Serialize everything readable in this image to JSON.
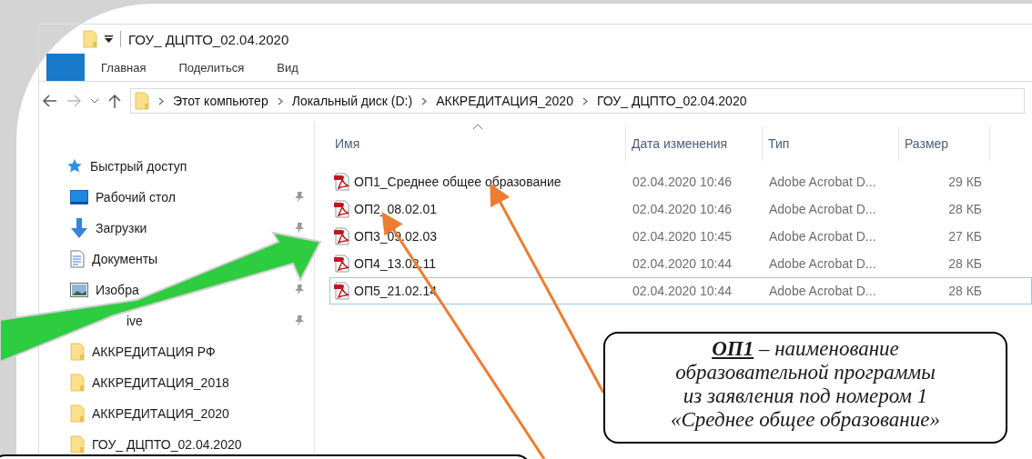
{
  "window": {
    "title": "ГОУ_ ДЦПТО_02.04.2020"
  },
  "ribbon": {
    "tabs": [
      {
        "label": "Главная"
      },
      {
        "label": "Поделиться"
      },
      {
        "label": "Вид"
      }
    ]
  },
  "address_bar": {
    "path": [
      "Этот компьютер",
      "Локальный диск (D:)",
      "АККРЕДИТАЦИЯ_2020",
      "ГОУ_ ДЦПТО_02.04.2020"
    ]
  },
  "sidebar": {
    "items": [
      {
        "kind": "quick-access",
        "label": "Быстрый доступ",
        "pinned": false
      },
      {
        "kind": "desktop",
        "label": "Рабочий стол",
        "pinned": true
      },
      {
        "kind": "downloads",
        "label": "Загрузки",
        "pinned": true
      },
      {
        "kind": "documents",
        "label": "Документы",
        "pinned": false
      },
      {
        "kind": "pictures",
        "label": "Изобра",
        "pinned": true
      },
      {
        "kind": "cloud",
        "label": "ive",
        "pinned": true
      },
      {
        "kind": "folder",
        "label": "АККРЕДИТАЦИЯ РФ",
        "pinned": false
      },
      {
        "kind": "folder",
        "label": "АККРЕДИТАЦИЯ_2018",
        "pinned": false
      },
      {
        "kind": "folder",
        "label": "АККРЕДИТАЦИЯ_2020",
        "pinned": false
      },
      {
        "kind": "folder",
        "label": "ГОУ_ ДЦПТО_02.04.2020",
        "pinned": false
      }
    ]
  },
  "file_list": {
    "columns": [
      {
        "label": "Имя",
        "sorted": true
      },
      {
        "label": "Дата изменения",
        "sorted": false
      },
      {
        "label": "Тип",
        "sorted": false
      },
      {
        "label": "Размер",
        "sorted": false
      }
    ],
    "rows": [
      {
        "name": "ОП1_Среднее общее образование",
        "modified": "02.04.2020 10:46",
        "type": "Adobe Acrobat D...",
        "size": "29 КБ",
        "focused": false
      },
      {
        "name": "ОП2_08.02.01",
        "modified": "02.04.2020 10:46",
        "type": "Adobe Acrobat D...",
        "size": "28 КБ",
        "focused": false
      },
      {
        "name": "ОП3_09.02.03",
        "modified": "02.04.2020 10:45",
        "type": "Adobe Acrobat D...",
        "size": "27 КБ",
        "focused": false
      },
      {
        "name": "ОП4_13.02.11",
        "modified": "02.04.2020 10:44",
        "type": "Adobe Acrobat D...",
        "size": "28 КБ",
        "focused": false
      },
      {
        "name": "ОП5_21.02.14",
        "modified": "02.04.2020 10:44",
        "type": "Adobe Acrobat D...",
        "size": "28 КБ",
        "focused": true
      }
    ]
  },
  "annotation": {
    "callout": "**ОП1** – наименование\nобразовательной программы\nиз заявления под номером 1\n«Среднее общее образование»"
  }
}
